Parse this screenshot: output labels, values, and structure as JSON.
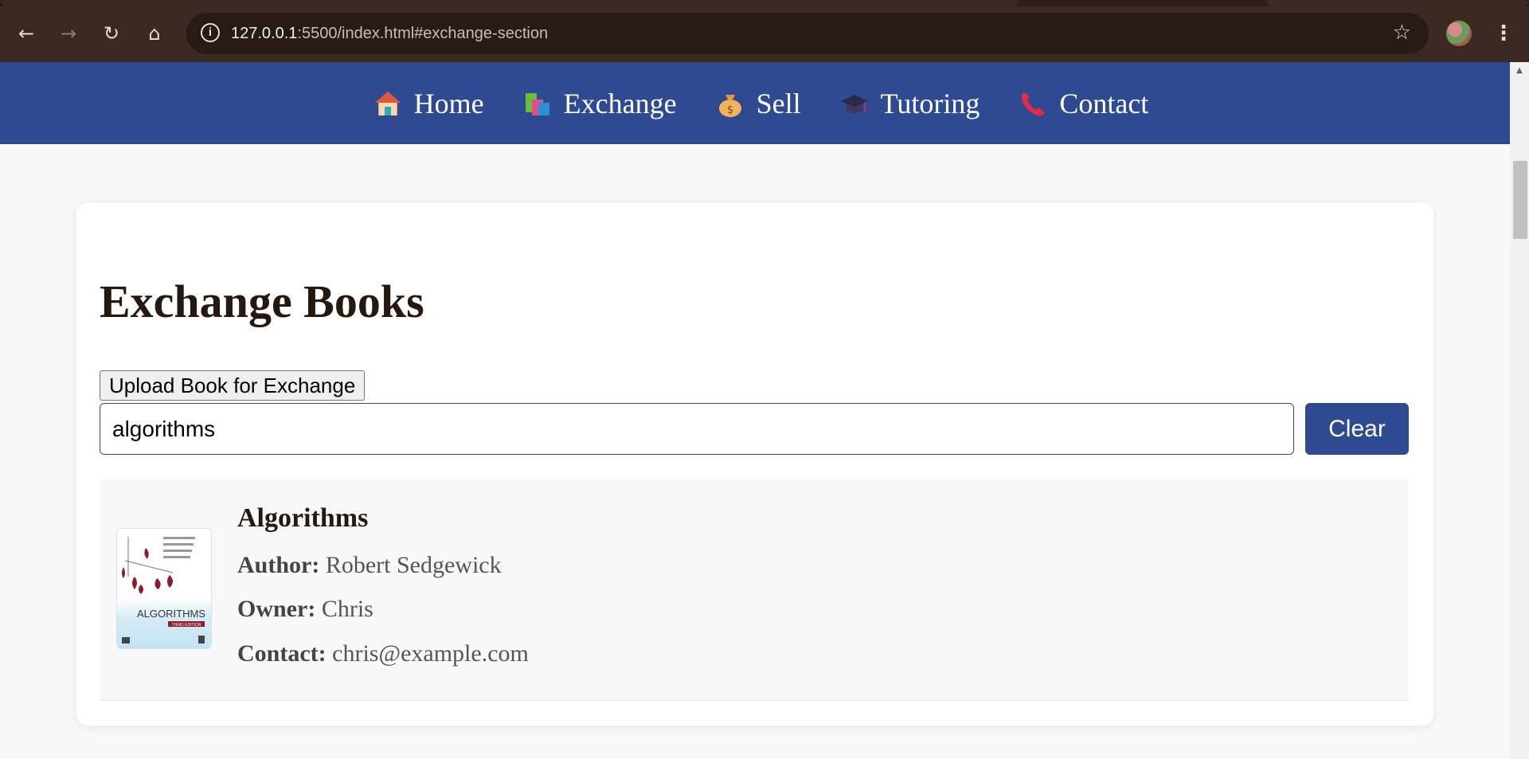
{
  "browser": {
    "url_host": "127.0.0.1",
    "url_rest": ":5500/index.html#exchange-section",
    "info_glyph": "i",
    "back_glyph": "←",
    "forward_glyph": "→",
    "reload_glyph": "↻",
    "home_glyph": "⌂",
    "star_glyph": "☆",
    "menu_glyph": "⋮"
  },
  "nav": {
    "items": [
      {
        "label": "Home",
        "icon": "house-icon"
      },
      {
        "label": "Exchange",
        "icon": "books-icon"
      },
      {
        "label": "Sell",
        "icon": "money-bag-icon"
      },
      {
        "label": "Tutoring",
        "icon": "graduation-cap-icon"
      },
      {
        "label": "Contact",
        "icon": "telephone-icon"
      }
    ]
  },
  "exchange": {
    "title": "Exchange Books",
    "upload_label": "Upload Book for Exchange",
    "search_value": "algorithms",
    "clear_label": "Clear"
  },
  "result": {
    "title": "Algorithms",
    "author_label": "Author:",
    "author": "Robert Sedgewick",
    "owner_label": "Owner:",
    "owner": "Chris",
    "contact_label": "Contact:",
    "contact": "chris@example.com",
    "cover": {
      "title": "ALGORITHMS",
      "edition": "THIRD EDITION"
    }
  },
  "colors": {
    "nav_bg": "#2e4a90",
    "button_bg": "#2e4a90",
    "heading": "#24180f",
    "chrome": "#3a2a22"
  }
}
